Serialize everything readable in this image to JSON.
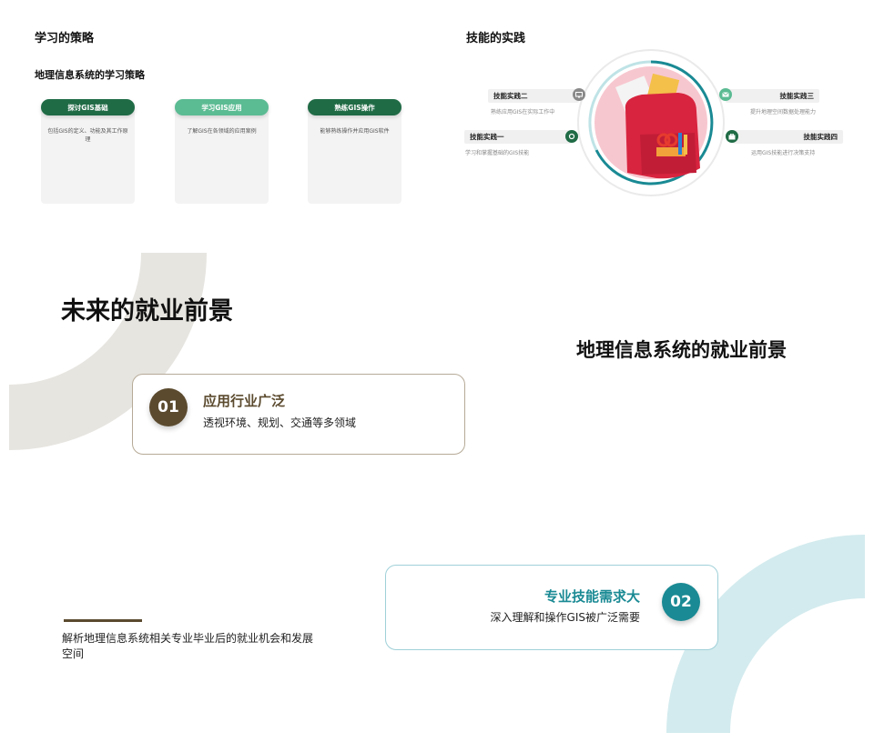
{
  "learning": {
    "title": "学习的策略",
    "subtitle": "地理信息系统的学习策略",
    "cards": [
      {
        "label": "探讨GIS基础",
        "desc": "包括GIS的定义、功能及其工作原理",
        "color": "#1f6b46"
      },
      {
        "label": "学习GIS应用",
        "desc": "了解GIS在各领域的应用案例",
        "color": "#5bbb93"
      },
      {
        "label": "熟练GIS操作",
        "desc": "能够熟练操作并应用GIS软件",
        "color": "#1f6b46"
      }
    ]
  },
  "skills": {
    "title": "技能的实践",
    "items": [
      {
        "label": "技能实践二",
        "desc": "熟练应用GIS在实际工作中",
        "icon": "monitor-icon"
      },
      {
        "label": "技能实践一",
        "desc": "学习和掌握基础的GIS技能",
        "icon": "location-pin-icon"
      },
      {
        "label": "技能实践三",
        "desc": "提升地理空间数据处理能力",
        "icon": "mail-icon"
      },
      {
        "label": "技能实践四",
        "desc": "运用GIS技能进行决策支持",
        "icon": "briefcase-icon"
      }
    ]
  },
  "future": {
    "title": "未来的就业前景",
    "subtitle": "地理信息系统的就业前景",
    "point1": {
      "number": "01",
      "heading": "应用行业广泛",
      "text": "透视环境、规划、交通等多领域",
      "color": "#5b4a2e"
    },
    "point2": {
      "number": "02",
      "heading": "专业技能需求大",
      "text": "深入理解和操作GIS被广泛需要",
      "color": "#1a8a94"
    },
    "description": "解析地理信息系统相关专业毕业后的就业机会和发展空间"
  }
}
